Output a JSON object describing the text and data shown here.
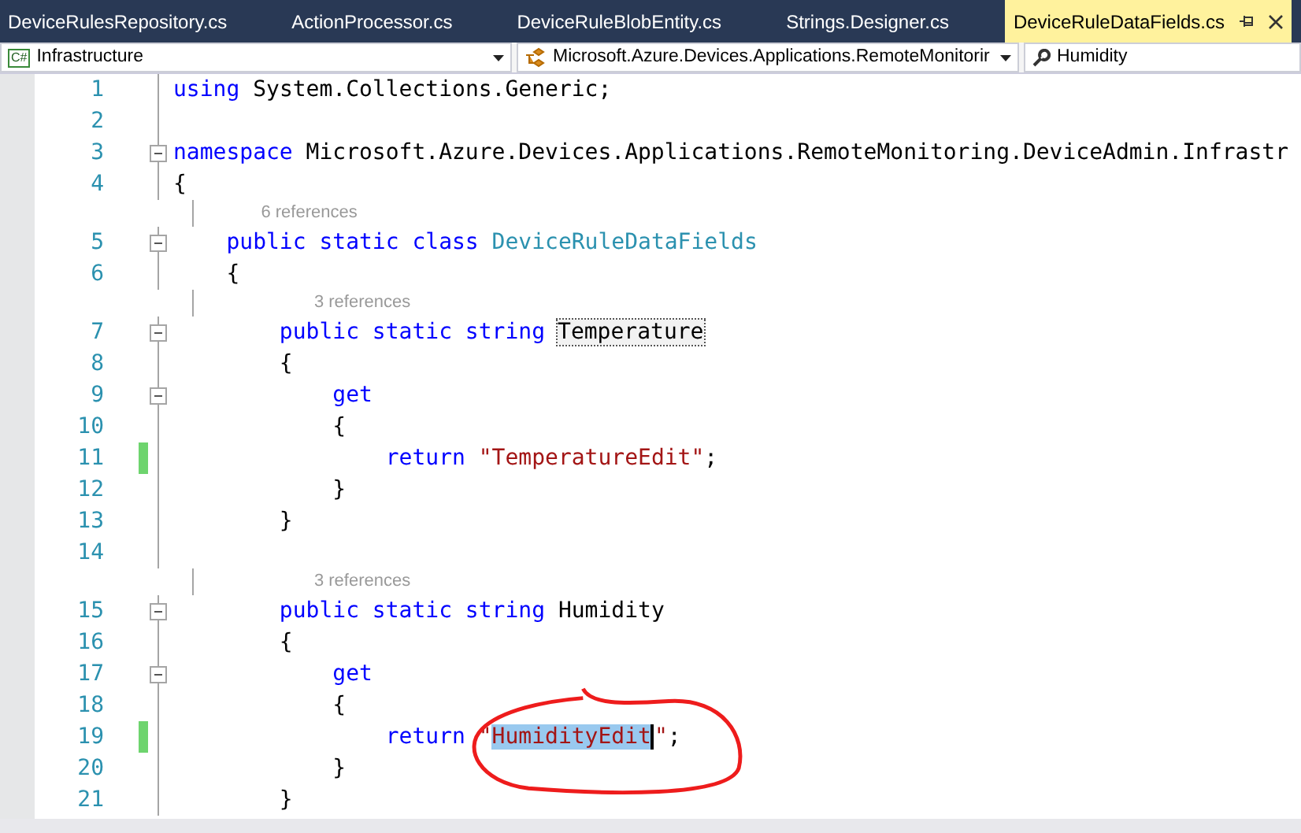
{
  "tabs": [
    {
      "label": "DeviceRulesRepository.cs",
      "selected": false
    },
    {
      "label": "ActionProcessor.cs",
      "selected": false
    },
    {
      "label": "DeviceRuleBlobEntity.cs",
      "selected": false
    },
    {
      "label": "Strings.Designer.cs",
      "selected": false
    },
    {
      "label": "DeviceRuleDataFields.cs",
      "selected": true
    }
  ],
  "navigation_bar": {
    "project": {
      "badge": "C#",
      "label": "Infrastructure"
    },
    "type": {
      "label": "Microsoft.Azure.Devices.Applications.RemoteMonitorir"
    },
    "member": {
      "label": "Humidity"
    }
  },
  "lines": [
    {
      "number": "1",
      "changed": false,
      "fold": false,
      "tokens": [
        {
          "kind": "keyword",
          "text": "using"
        },
        {
          "kind": "plain",
          "text": " System.Collections.Generic;"
        }
      ]
    },
    {
      "number": "2",
      "changed": false,
      "fold": false
    },
    {
      "number": "3",
      "changed": false,
      "fold": true,
      "tokens": [
        {
          "kind": "keyword",
          "text": "namespace"
        },
        {
          "kind": "plain",
          "text": " Microsoft.Azure.Devices.Applications.RemoteMonitoring.DeviceAdmin.Infrastr"
        }
      ]
    },
    {
      "number": "4",
      "changed": false,
      "fold": false,
      "tokens": [
        {
          "kind": "plain",
          "text": "{"
        }
      ]
    },
    {
      "number": "5",
      "references": "6 references",
      "changed": false,
      "fold": true,
      "tokens": [
        {
          "kind": "keyword",
          "text": "    public static class"
        },
        {
          "kind": "type",
          "text": " DeviceRuleDataFields"
        }
      ]
    },
    {
      "number": "6",
      "changed": false,
      "fold": false,
      "tokens": [
        {
          "kind": "plain",
          "text": "    {"
        }
      ]
    },
    {
      "number": "7",
      "references": "3 references",
      "changed": false,
      "fold": true,
      "tokens": [
        {
          "kind": "keyword",
          "text": "        public static string"
        },
        {
          "kind": "highlight",
          "text": "Temperature"
        }
      ]
    },
    {
      "number": "8",
      "changed": false,
      "fold": false,
      "tokens": [
        {
          "kind": "plain",
          "text": "        {"
        }
      ]
    },
    {
      "number": "9",
      "changed": false,
      "fold": true,
      "tokens": [
        {
          "kind": "keyword",
          "text": "            get"
        }
      ]
    },
    {
      "number": "10",
      "changed": false,
      "fold": false,
      "tokens": [
        {
          "kind": "plain",
          "text": "            {"
        }
      ]
    },
    {
      "number": "11",
      "changed": true,
      "fold": false,
      "tokens": [
        {
          "kind": "keyword",
          "text": "                return"
        },
        {
          "kind": "string",
          "text": " \"TemperatureEdit\""
        },
        {
          "kind": "plain",
          "text": ";"
        }
      ]
    },
    {
      "number": "12",
      "changed": false,
      "fold": false,
      "tokens": [
        {
          "kind": "plain",
          "text": "            }"
        }
      ]
    },
    {
      "number": "13",
      "changed": false,
      "fold": false,
      "tokens": [
        {
          "kind": "plain",
          "text": "        }"
        }
      ]
    },
    {
      "number": "14",
      "changed": false,
      "fold": false
    },
    {
      "number": "15",
      "references": "3 references",
      "changed": false,
      "fold": true,
      "tokens": [
        {
          "kind": "keyword",
          "text": "        public static string"
        },
        {
          "kind": "plain",
          "text": " Humidity"
        }
      ]
    },
    {
      "number": "16",
      "changed": false,
      "fold": false,
      "tokens": [
        {
          "kind": "plain",
          "text": "        {"
        }
      ]
    },
    {
      "number": "17",
      "changed": false,
      "fold": true,
      "tokens": [
        {
          "kind": "keyword",
          "text": "            get"
        }
      ]
    },
    {
      "number": "18",
      "changed": false,
      "fold": false,
      "tokens": [
        {
          "kind": "plain",
          "text": "            {"
        }
      ]
    },
    {
      "number": "19",
      "changed": true,
      "fold": false,
      "tokens": [
        {
          "kind": "keyword",
          "text": "                return"
        },
        {
          "kind": "string",
          "text": " \""
        },
        {
          "kind": "selection",
          "text": "HumidityEdit"
        },
        {
          "kind": "string",
          "text": "\""
        },
        {
          "kind": "plain",
          "text": ";"
        }
      ]
    },
    {
      "number": "20",
      "changed": false,
      "fold": false,
      "tokens": [
        {
          "kind": "plain",
          "text": "            }"
        }
      ]
    },
    {
      "number": "21",
      "changed": false,
      "fold": false,
      "tokens": [
        {
          "kind": "plain",
          "text": "        }"
        }
      ]
    }
  ]
}
